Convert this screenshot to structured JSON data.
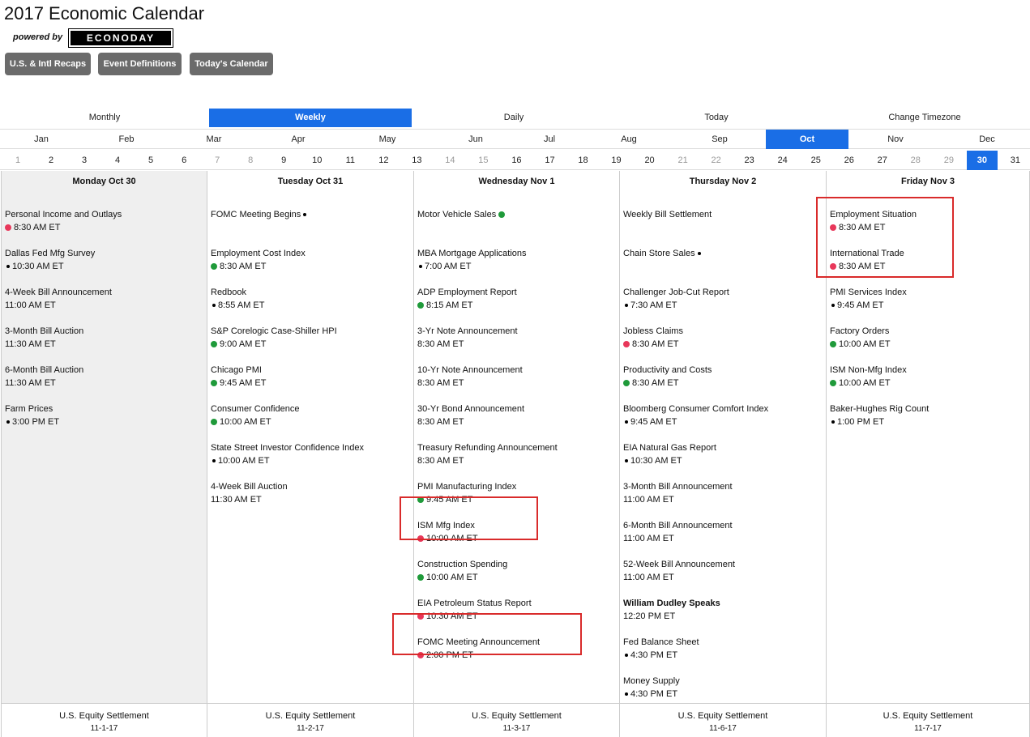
{
  "header": {
    "title": "2017 Economic Calendar",
    "powered_by": "powered by",
    "logo_text": "ECONODAY",
    "buttons": [
      "U.S. & Intl Recaps",
      "Event Definitions",
      "Today's Calendar"
    ]
  },
  "views": [
    "Monthly",
    "Weekly",
    "Daily",
    "Today",
    "Change Timezone"
  ],
  "active_view": "Weekly",
  "months": [
    "Jan",
    "Feb",
    "Mar",
    "Apr",
    "May",
    "Jun",
    "Jul",
    "Aug",
    "Sep",
    "Oct",
    "Nov",
    "Dec"
  ],
  "active_month": "Oct",
  "days": [
    "1",
    "2",
    "3",
    "4",
    "5",
    "6",
    "7",
    "8",
    "9",
    "10",
    "11",
    "12",
    "13",
    "14",
    "15",
    "16",
    "17",
    "18",
    "19",
    "20",
    "21",
    "22",
    "23",
    "24",
    "25",
    "26",
    "27",
    "28",
    "29",
    "30",
    "31"
  ],
  "muted_days": [
    "1",
    "7",
    "8",
    "14",
    "15",
    "21",
    "22",
    "28",
    "29"
  ],
  "active_day": "30",
  "colors": {
    "accent": "#1a6ee6",
    "red_dot": "#e8375a",
    "green_dot": "#1f9a3a",
    "highlight": "#d92b2b",
    "button": "#6b6b6b"
  },
  "columns": [
    {
      "header": "Monday Oct 30",
      "events": [
        {
          "name": "Personal Income and Outlays",
          "time": "8:30 AM ET",
          "dot": "red"
        },
        {
          "name": "Dallas Fed Mfg Survey",
          "time": "10:30 AM ET",
          "dot": "black"
        },
        {
          "name": "4-Week Bill Announcement",
          "time": "11:00 AM ET",
          "dot": ""
        },
        {
          "name": "3-Month Bill Auction",
          "time": "11:30 AM ET",
          "dot": ""
        },
        {
          "name": "6-Month Bill Auction",
          "time": "11:30 AM ET",
          "dot": ""
        },
        {
          "name": "Farm Prices",
          "time": "3:00 PM ET",
          "dot": "black"
        }
      ],
      "footer": {
        "label": "U.S. Equity Settlement",
        "date": "11-1-17"
      }
    },
    {
      "header": "Tuesday Oct 31",
      "events": [
        {
          "name": "FOMC Meeting Begins",
          "time": "",
          "dot": "black-after"
        },
        {
          "name": "Employment Cost Index",
          "time": "8:30 AM ET",
          "dot": "green"
        },
        {
          "name": "Redbook",
          "time": "8:55 AM ET",
          "dot": "black"
        },
        {
          "name": "S&P Corelogic Case-Shiller HPI",
          "time": "9:00 AM ET",
          "dot": "green"
        },
        {
          "name": "Chicago PMI",
          "time": "9:45 AM ET",
          "dot": "green"
        },
        {
          "name": "Consumer Confidence",
          "time": "10:00 AM ET",
          "dot": "green"
        },
        {
          "name": "State Street Investor Confidence Index",
          "time": "10:00 AM ET",
          "dot": "black"
        },
        {
          "name": "4-Week Bill Auction",
          "time": "11:30 AM ET",
          "dot": ""
        }
      ],
      "footer": {
        "label": "U.S. Equity Settlement",
        "date": "11-2-17"
      }
    },
    {
      "header": "Wednesday Nov 1",
      "events": [
        {
          "name": "Motor Vehicle Sales",
          "time": "",
          "dot": "green-after"
        },
        {
          "name": "MBA Mortgage Applications",
          "time": "7:00 AM ET",
          "dot": "black"
        },
        {
          "name": "ADP Employment Report",
          "time": "8:15 AM ET",
          "dot": "green"
        },
        {
          "name": "3-Yr Note Announcement",
          "time": "8:30 AM ET",
          "dot": ""
        },
        {
          "name": "10-Yr Note Announcement",
          "time": "8:30 AM ET",
          "dot": ""
        },
        {
          "name": "30-Yr Bond Announcement",
          "time": "8:30 AM ET",
          "dot": ""
        },
        {
          "name": "Treasury Refunding Announcement",
          "time": "8:30 AM ET",
          "dot": ""
        },
        {
          "name": "PMI Manufacturing Index",
          "time": "9:45 AM ET",
          "dot": "green"
        },
        {
          "name": "ISM Mfg Index",
          "time": "10:00 AM ET",
          "dot": "red"
        },
        {
          "name": "Construction Spending",
          "time": "10:00 AM ET",
          "dot": "green"
        },
        {
          "name": "EIA Petroleum Status Report",
          "time": "10:30 AM ET",
          "dot": "red"
        },
        {
          "name": "FOMC Meeting Announcement",
          "time": "2:00 PM ET",
          "dot": "red"
        }
      ],
      "footer": {
        "label": "U.S. Equity Settlement",
        "date": "11-3-17"
      }
    },
    {
      "header": "Thursday Nov 2",
      "events": [
        {
          "name": "Weekly Bill Settlement",
          "time": "",
          "dot": ""
        },
        {
          "name": "Chain Store Sales",
          "time": "",
          "dot": "black-after"
        },
        {
          "name": "Challenger Job-Cut Report",
          "time": "7:30 AM ET",
          "dot": "black"
        },
        {
          "name": "Jobless Claims",
          "time": "8:30 AM ET",
          "dot": "red"
        },
        {
          "name": "Productivity and Costs",
          "time": "8:30 AM ET",
          "dot": "green"
        },
        {
          "name": "Bloomberg Consumer Comfort Index",
          "time": "9:45 AM ET",
          "dot": "black"
        },
        {
          "name": "EIA Natural Gas Report",
          "time": "10:30 AM ET",
          "dot": "black"
        },
        {
          "name": "3-Month Bill Announcement",
          "time": "11:00 AM ET",
          "dot": ""
        },
        {
          "name": "6-Month Bill Announcement",
          "time": "11:00 AM ET",
          "dot": ""
        },
        {
          "name": "52-Week Bill Announcement",
          "time": "11:00 AM ET",
          "dot": ""
        },
        {
          "name": "William Dudley Speaks",
          "time": "12:20 PM ET",
          "dot": "",
          "bold": true
        },
        {
          "name": "Fed Balance Sheet",
          "time": "4:30 PM ET",
          "dot": "black"
        },
        {
          "name": "Money Supply",
          "time": "4:30 PM ET",
          "dot": "black"
        }
      ],
      "footer": {
        "label": "U.S. Equity Settlement",
        "date": "11-6-17"
      }
    },
    {
      "header": "Friday Nov 3",
      "events": [
        {
          "name": "Employment Situation",
          "time": "8:30 AM ET",
          "dot": "red"
        },
        {
          "name": "International Trade",
          "time": "8:30 AM ET",
          "dot": "red"
        },
        {
          "name": "PMI Services Index",
          "time": "9:45 AM ET",
          "dot": "black"
        },
        {
          "name": "Factory Orders",
          "time": "10:00 AM ET",
          "dot": "green"
        },
        {
          "name": "ISM Non-Mfg Index",
          "time": "10:00 AM ET",
          "dot": "green"
        },
        {
          "name": "Baker-Hughes Rig Count",
          "time": "1:00 PM ET",
          "dot": "black"
        }
      ],
      "footer": {
        "label": "U.S. Equity Settlement",
        "date": "11-7-17"
      }
    }
  ]
}
